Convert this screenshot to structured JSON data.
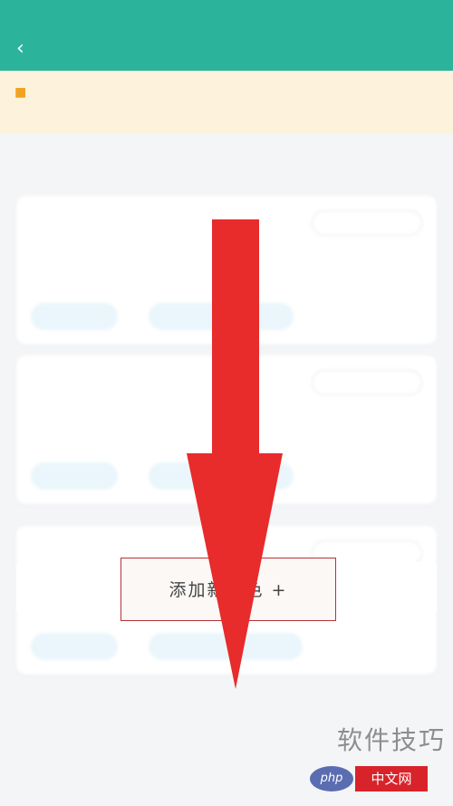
{
  "colors": {
    "accent": "#2bb39c",
    "arrow": "#e82b2b",
    "highlight_border": "#b8323a"
  },
  "status_bar": {
    "left": "",
    "time": "",
    "right": ""
  },
  "header": {
    "title": "",
    "back_icon": "chevron-left-icon"
  },
  "notice": {
    "icon": "warning-icon",
    "text": ""
  },
  "content": {
    "section_label": ""
  },
  "roles": [
    {
      "name": "",
      "edit_label": "",
      "description": "",
      "tags": [
        "",
        ""
      ]
    },
    {
      "name": "",
      "edit_label": "",
      "description": "",
      "tags": [
        "",
        ""
      ]
    },
    {
      "name": "",
      "edit_label": "",
      "description": "",
      "tags": [
        "",
        ""
      ]
    }
  ],
  "add_role_button": {
    "label": "添加新角色 +"
  },
  "watermark": {
    "title": "软件技巧",
    "logo_left": "php",
    "logo_right": "中文网"
  }
}
